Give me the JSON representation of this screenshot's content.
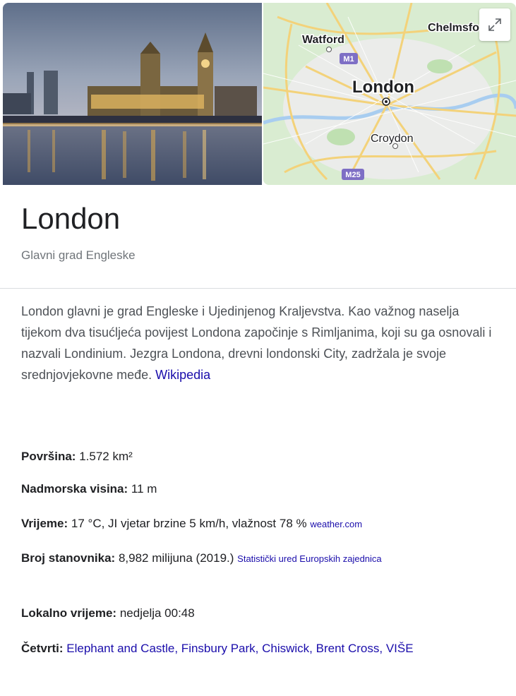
{
  "header": {
    "title": "London",
    "subtitle": "Glavni grad Engleske"
  },
  "map": {
    "labels": {
      "watford": "Watford",
      "chelmsford": "Chelmsford",
      "london": "London",
      "croydon": "Croydon",
      "m1": "M1",
      "m25": "M25"
    },
    "colors": {
      "land": "#d9ecd1",
      "road": "#f3d27a",
      "water": "#a8cdf0",
      "shield": "#7e6fc5"
    }
  },
  "description": {
    "text": "London glavni je grad Engleske i Ujedinjenog Kraljevstva. Kao važnog naselja tijekom dva tisućljeća povijest Londona započinje s Rimljanima, koji su ga osnovali i nazvali Londinium. Jezgra Londona, drevni londonski City, zadržala je svoje srednjovjekovne međe.",
    "link": "Wikipedia"
  },
  "facts": {
    "area": {
      "label": "Površina:",
      "value": "1.572 km²"
    },
    "elevation": {
      "label": "Nadmorska visina:",
      "value": "11 m"
    },
    "weather": {
      "label": "Vrijeme:",
      "value": "17 °C, JI vjetar brzine 5 km/h, vlažnost 78 %",
      "source": "weather.com"
    },
    "population": {
      "label": "Broj stanovnika:",
      "value": "8,982 milijuna (2019.)",
      "source": "Statistički ured Europskih zajednica"
    },
    "local_time": {
      "label": "Lokalno vrijeme:",
      "value": "nedjelja 00:48"
    },
    "districts": {
      "label": "Četvrti:",
      "items": "Elephant and Castle, Finsbury Park, Chiswick, Brent Cross,",
      "more": "VIŠE"
    }
  },
  "colors": {
    "link": "#1a0dab",
    "text": "#202124",
    "muted": "#70757a"
  }
}
